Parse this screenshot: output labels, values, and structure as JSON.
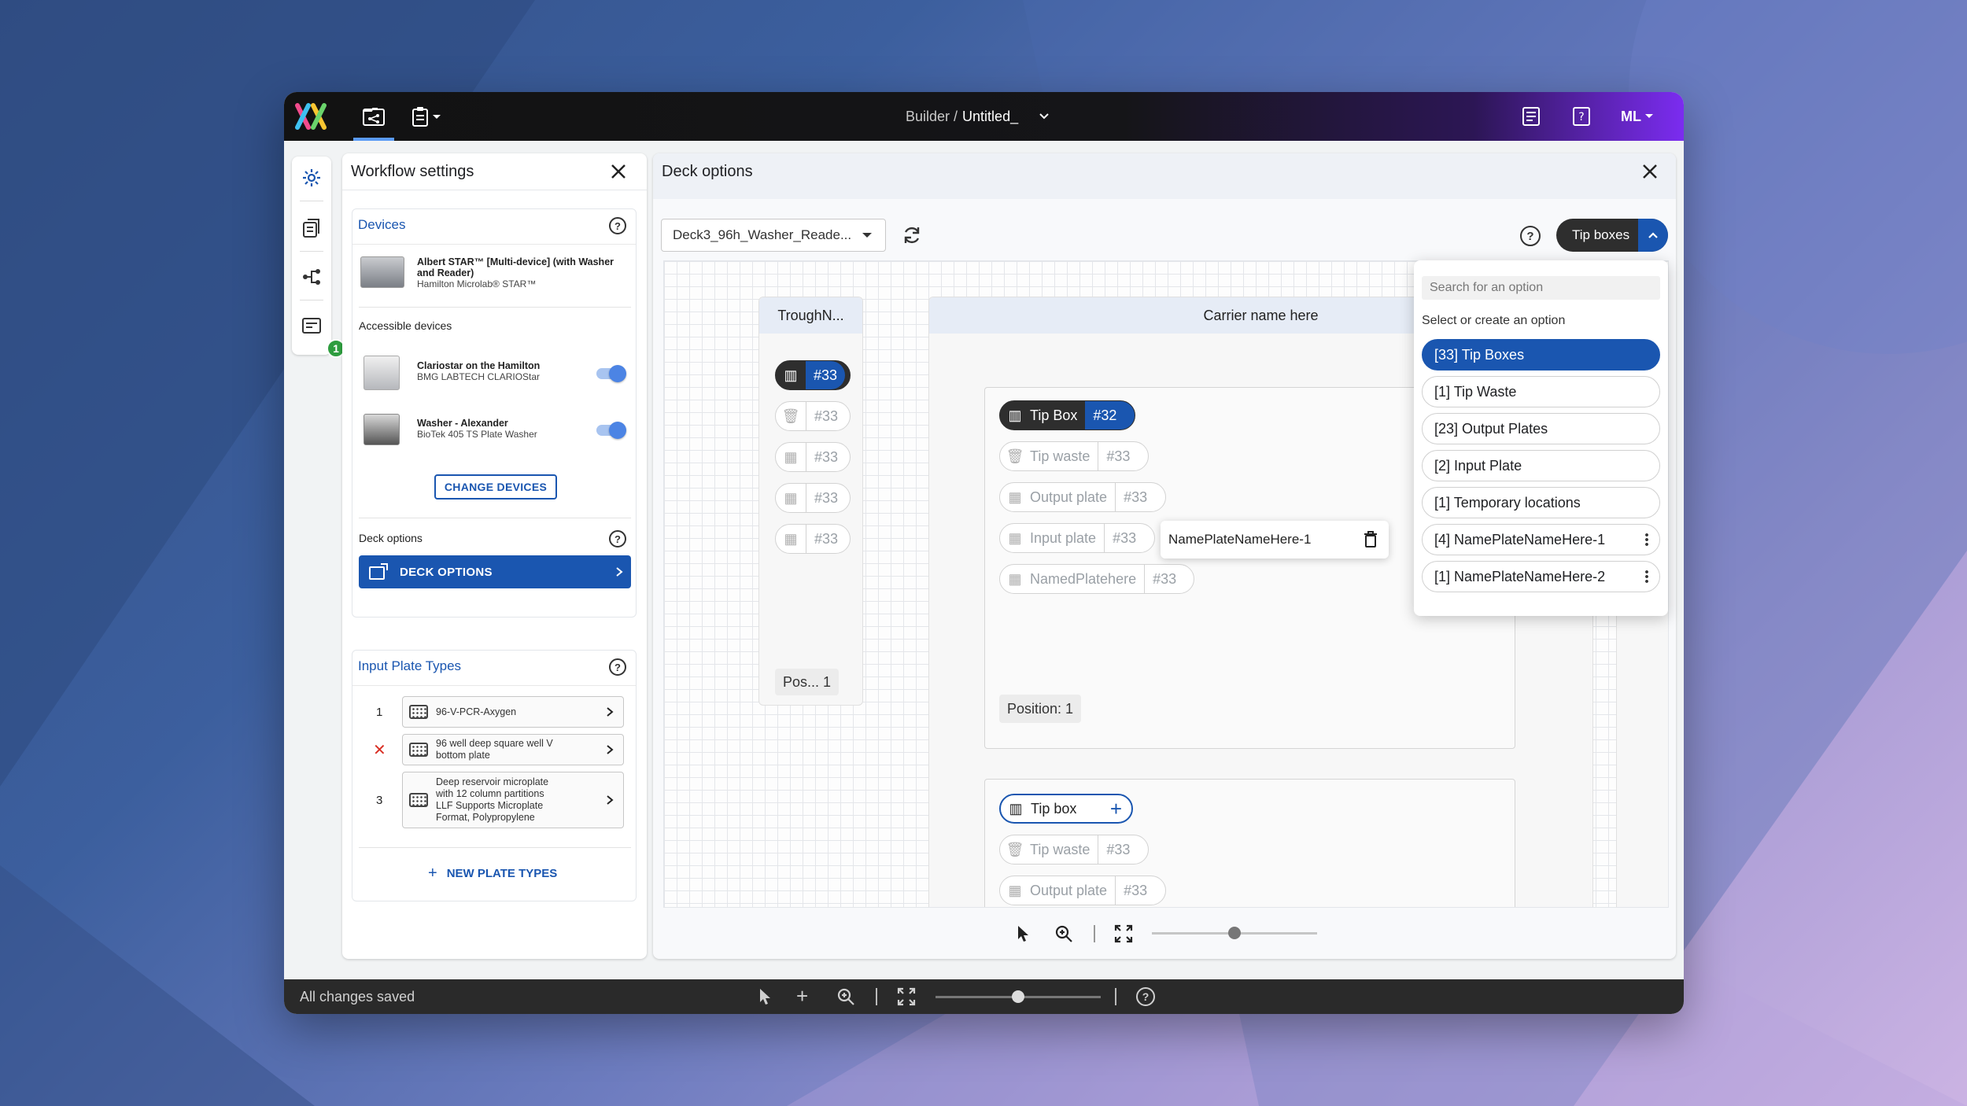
{
  "app": {
    "breadcrumb_prefix": "Builder /",
    "file_name": "Untitled_",
    "user_initials": "ML",
    "status": "All changes saved",
    "side_badge": "1"
  },
  "workflow": {
    "title": "Workflow settings",
    "devices_title": "Devices",
    "main_device": {
      "name": "Albert STAR™ [Multi-device] (with Washer and Reader)",
      "model": "Hamilton Microlab® STAR™"
    },
    "accessible_title": "Accessible devices",
    "accessible": [
      {
        "name": "Clariostar on the Hamilton",
        "model": "BMG LABTECH CLARIOStar"
      },
      {
        "name": "Washer - Alexander",
        "model": "BioTek 405 TS Plate Washer"
      }
    ],
    "change_devices": "CHANGE DEVICES",
    "deck_options_label": "Deck options",
    "deck_options_button": "DECK OPTIONS",
    "plate_types_title": "Input Plate Types",
    "plates": [
      {
        "index": "1",
        "name": "96-V-PCR-Axygen"
      },
      {
        "index": "✕",
        "name": "96 well deep square well V bottom plate"
      },
      {
        "index": "3",
        "name": "Deep reservoir microplate with 12 column partitions LLF Supports Microplate Format, Polypropylene"
      }
    ],
    "new_plate_types": "NEW PLATE TYPES"
  },
  "deck": {
    "title": "Deck options",
    "deck_select": "Deck3_96h_Washer_Reade...",
    "filter_label": "Tip boxes",
    "trough": {
      "title": "TroughN...",
      "slots": [
        "#33",
        "#33",
        "#33",
        "#33",
        "#33"
      ],
      "position": "Pos... 1"
    },
    "carrier": {
      "title": "Carrier name here",
      "chips": [
        {
          "label": "Tip Box",
          "num": "#32"
        },
        {
          "label": "Tip waste",
          "num": "#33"
        },
        {
          "label": "Output plate",
          "num": "#33"
        },
        {
          "label": "Input plate",
          "num": "#33"
        },
        {
          "label": "NamedPlatehere",
          "num": "#33"
        }
      ],
      "position": "Position: 1",
      "popover_name": "NamePlateNameHere-1",
      "chips2": [
        {
          "label": "Tip box",
          "num": "+"
        },
        {
          "label": "Tip waste",
          "num": "#33"
        },
        {
          "label": "Output plate",
          "num": "#33"
        }
      ]
    },
    "slider_value": 0.5
  },
  "dropdown": {
    "search_placeholder": "Search for an option",
    "hint": "Select or create an option",
    "options": [
      "[33] Tip Boxes",
      "[1] Tip Waste",
      "[23] Output Plates",
      "[2] Input Plate",
      "[1] Temporary locations",
      "[4] NamePlateNameHere-1",
      "[1] NamePlateNameHere-2"
    ]
  },
  "colors": {
    "accent": "#1a56b0",
    "success": "#2e9d3f",
    "danger": "#d93025"
  }
}
